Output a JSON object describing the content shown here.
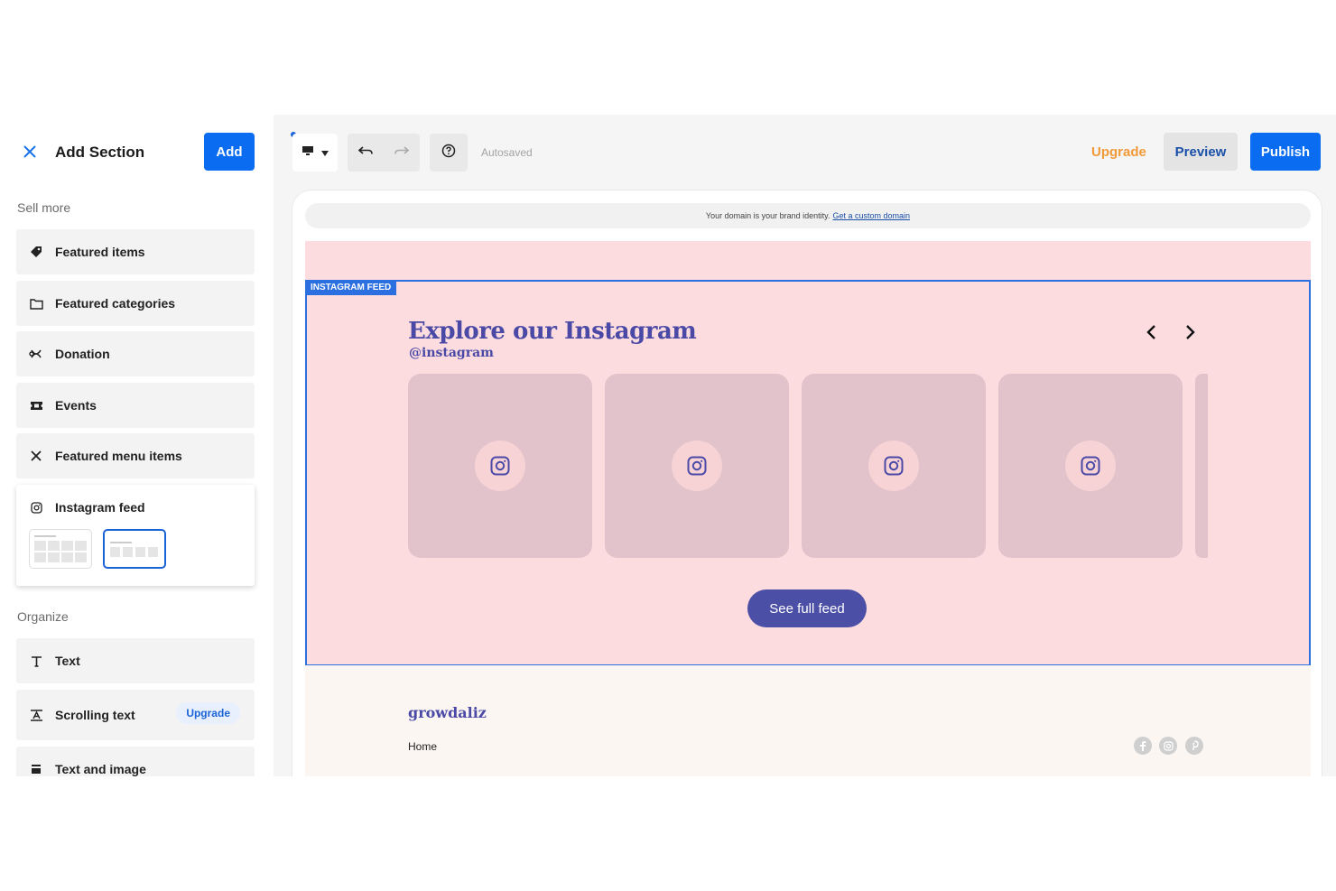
{
  "sidebar": {
    "title": "Add Section",
    "add_label": "Add",
    "groups": [
      {
        "label": "Sell more"
      },
      {
        "label": "Organize"
      }
    ],
    "sell_items": [
      {
        "label": "Featured items",
        "icon": "tag-icon"
      },
      {
        "label": "Featured categories",
        "icon": "folder-icon"
      },
      {
        "label": "Donation",
        "icon": "ribbon-icon"
      },
      {
        "label": "Events",
        "icon": "ticket-icon"
      },
      {
        "label": "Featured menu items",
        "icon": "utensils-icon"
      }
    ],
    "expanded_item": {
      "label": "Instagram feed",
      "icon": "instagram-icon"
    },
    "organize_items": [
      {
        "label": "Text",
        "icon": "text-icon"
      },
      {
        "label": "Scrolling text",
        "icon": "scrolling-text-icon",
        "badge": "Upgrade"
      },
      {
        "label": "Text and image",
        "icon": "text-image-icon"
      }
    ]
  },
  "toolbar": {
    "status": "Autosaved",
    "upgrade_label": "Upgrade",
    "preview_label": "Preview",
    "publish_label": "Publish"
  },
  "canvas": {
    "domain_text": "Your domain is your brand identity.",
    "domain_link": "Get a custom domain",
    "section_tag": "INSTAGRAM FEED",
    "ig_title": "Explore our Instagram",
    "ig_handle": "@instagram",
    "see_feed_label": "See full feed",
    "footer": {
      "brand": "growdaliz",
      "links": [
        "Home"
      ],
      "social": [
        "facebook-icon",
        "instagram-icon",
        "pinterest-icon"
      ]
    }
  },
  "colors": {
    "accent": "#0a6cf0",
    "brand_purple": "#4a4aa6",
    "section_bg": "#fddcdf",
    "upgrade": "#f09a38"
  }
}
